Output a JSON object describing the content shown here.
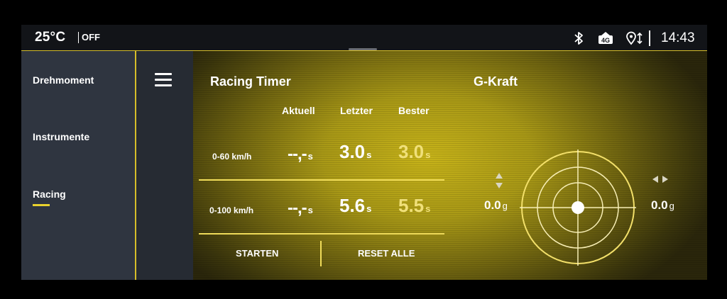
{
  "status": {
    "temperature": "25°C",
    "ac_state": "OFF",
    "time": "14:43",
    "icons": [
      "bluetooth-icon",
      "lte-4g-icon",
      "navigation-icon"
    ]
  },
  "sidebar": {
    "items": [
      {
        "label": "Drehmoment",
        "active": false
      },
      {
        "label": "Instrumente",
        "active": false
      },
      {
        "label": "Racing",
        "active": true
      }
    ],
    "accent": "#e9d22e"
  },
  "racing_timer": {
    "title": "Racing Timer",
    "columns": [
      "Aktuell",
      "Letzter",
      "Bester"
    ],
    "rows": [
      {
        "label": "0-60 km/h",
        "current": "--,-",
        "last": "3.0",
        "best": "3.0",
        "unit": "s"
      },
      {
        "label": "0-100 km/h",
        "current": "--,-",
        "last": "5.6",
        "best": "5.5",
        "unit": "s"
      }
    ],
    "buttons": {
      "start": "STARTEN",
      "reset": "RESET ALLE"
    }
  },
  "g_force": {
    "title": "G-Kraft",
    "longitudinal": "0.0",
    "lateral": "0.0",
    "unit": "g"
  },
  "colors": {
    "accent": "#d6be2a",
    "panel": "#b8a418"
  }
}
